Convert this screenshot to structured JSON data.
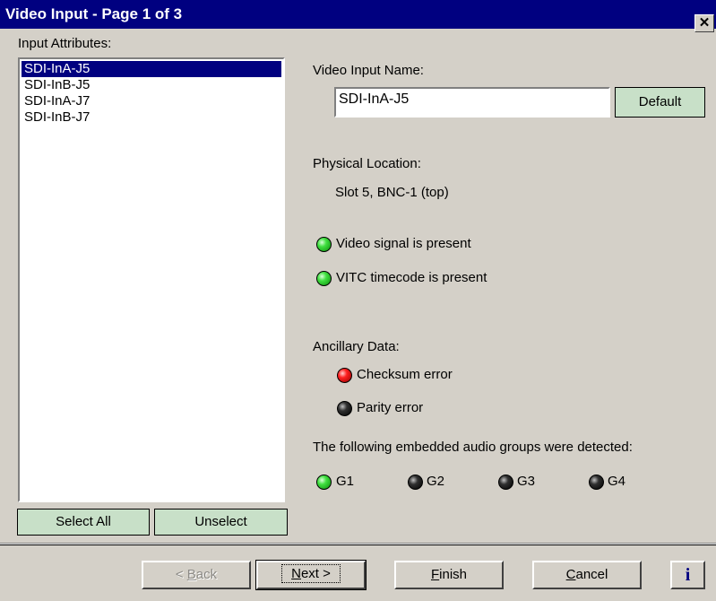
{
  "window": {
    "title": "Video Input - Page 1 of 3",
    "close_glyph": "✕"
  },
  "left_panel": {
    "label": "Input Attributes:",
    "items": [
      "SDI-InA-J5",
      "SDI-InB-J5",
      "SDI-InA-J7",
      "SDI-InB-J7"
    ],
    "selected_index": 0,
    "select_all_label": "Select All",
    "unselect_label": "Unselect"
  },
  "video_input": {
    "name_label": "Video Input Name:",
    "name_value": "SDI-InA-J5",
    "default_label": "Default"
  },
  "physical": {
    "label": "Physical Location:",
    "value": "Slot 5, BNC-1 (top)"
  },
  "status": {
    "video_signal": {
      "text": "Video signal is present",
      "color": "#22dd22"
    },
    "vitc": {
      "text": "VITC timecode is present",
      "color": "#22dd22"
    }
  },
  "ancillary": {
    "label": "Ancillary Data:",
    "checksum": {
      "text": "Checksum error",
      "color": "#ee1111"
    },
    "parity": {
      "text": "Parity error",
      "color": "#000000"
    }
  },
  "audio": {
    "label": "The following embedded audio groups were detected:",
    "groups": [
      {
        "name": "G1",
        "color": "#22dd22"
      },
      {
        "name": "G2",
        "color": "#000000"
      },
      {
        "name": "G3",
        "color": "#000000"
      },
      {
        "name": "G4",
        "color": "#000000"
      }
    ]
  },
  "footer": {
    "back": {
      "pre": "< ",
      "accel": "B",
      "post": "ack"
    },
    "next": {
      "accel": "N",
      "post": "ext >"
    },
    "finish": {
      "accel": "F",
      "post": "inish"
    },
    "cancel": {
      "accel": "C",
      "post": "ancel"
    },
    "info_glyph": "i"
  }
}
